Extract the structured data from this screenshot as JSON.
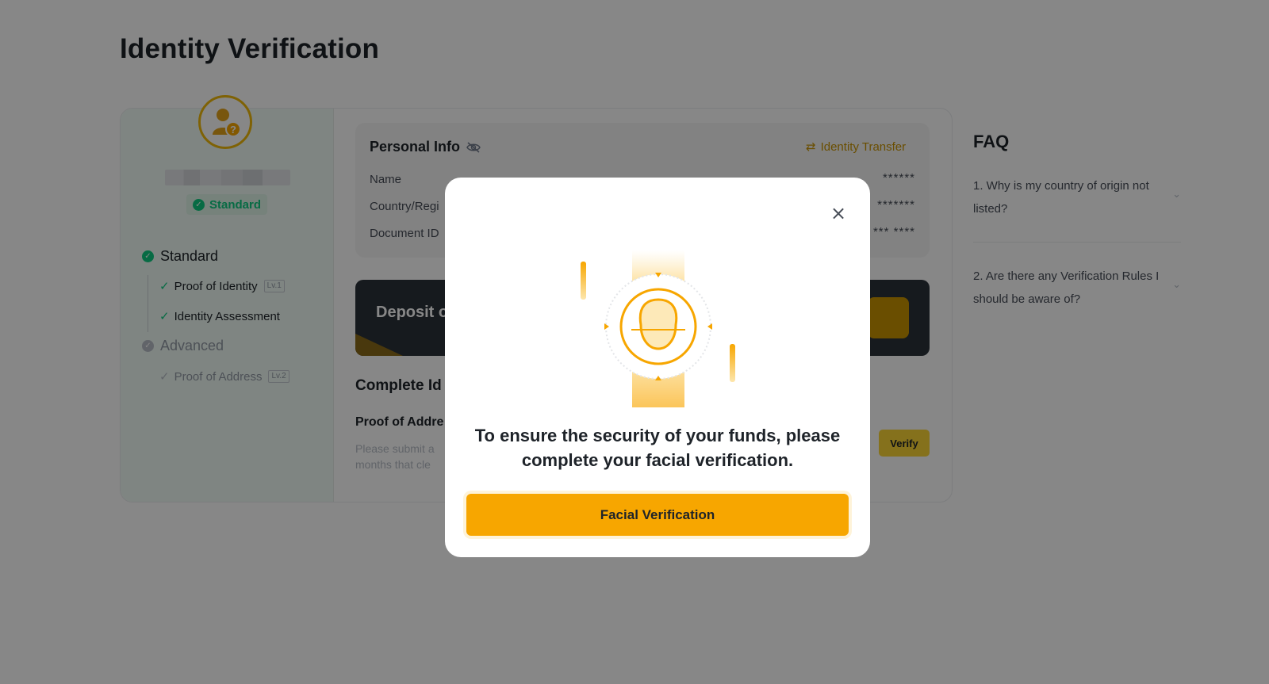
{
  "page": {
    "title": "Identity Verification"
  },
  "profile": {
    "status_badge": "Standard"
  },
  "levels": {
    "standard": {
      "label": "Standard",
      "steps": [
        {
          "label": "Proof of Identity",
          "tag": "Lv.1"
        },
        {
          "label": "Identity Assessment",
          "tag": ""
        }
      ]
    },
    "advanced": {
      "label": "Advanced",
      "steps": [
        {
          "label": "Proof of Address",
          "tag": "Lv.2"
        }
      ]
    }
  },
  "personal_info": {
    "title": "Personal Info",
    "transfer_link": "Identity Transfer",
    "rows": [
      {
        "label": "Name",
        "value": "******"
      },
      {
        "label": "Country/Regi",
        "value": "*******"
      },
      {
        "label": "Document ID",
        "value": "*** ****"
      }
    ]
  },
  "banner": {
    "text": "Deposit o"
  },
  "complete_section": {
    "title": "Complete Id",
    "poa_title": "Proof of Addre",
    "poa_desc_line1": "Please submit a",
    "poa_desc_line2": "months that cle",
    "verify_label": "Verify"
  },
  "faq": {
    "title": "FAQ",
    "items": [
      {
        "question": "1. Why is my country of origin not listed?"
      },
      {
        "question": "2. Are there any Verification Rules I should be aware of?"
      }
    ]
  },
  "modal": {
    "message": "To ensure the security of your funds, please complete your facial verification.",
    "button_label": "Facial Verification",
    "close_icon": "close-icon"
  },
  "colors": {
    "brand_yellow": "#f7a600",
    "success_green": "#0ecb81",
    "overlay": "rgba(0,0,0,0.47)"
  }
}
